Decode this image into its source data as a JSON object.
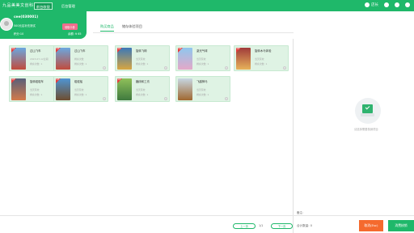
{
  "header": {
    "logo": "九品美美文创科技",
    "tabs": [
      {
        "label": "前台收银"
      },
      {
        "label": "后台管理"
      }
    ],
    "user_label": "店长",
    "colors": {
      "brand": "#1fb86a"
    }
  },
  "user": {
    "name": "cee(030001)",
    "shop": "500元店补充测试",
    "points": "积分:10",
    "action_button": "领取卡券",
    "balance": "余额: ¥ 65"
  },
  "tabs": [
    {
      "label": "购买商品"
    },
    {
      "label": "储存体验项目"
    }
  ],
  "cards": [
    {
      "title": "过山飞车",
      "line1": "2023-07-12过期",
      "line2": "剩余次数: 1",
      "tag": "免费"
    },
    {
      "title": "过山飞车",
      "line1": "剩余次数",
      "line2": "剩余次数: 1",
      "tag": "免费"
    },
    {
      "title": "旋转飞椅",
      "line1": "当天有效",
      "line2": "剩余次数: 1",
      "tag": "免费"
    },
    {
      "title": "激光气球",
      "line1": "当天有效",
      "line2": "剩余次数: 1",
      "tag": "免费"
    },
    {
      "title": "旋转木马体验",
      "line1": "当天有效",
      "line2": "剩余次数: 1",
      "tag": "免费"
    },
    {
      "title": "旋转碰碰车",
      "line1": "当天有效",
      "line2": "剩余次数: 1",
      "tag": "免费"
    },
    {
      "title": "碰碰船",
      "line1": "当天有效",
      "line2": "剩余次数: 1",
      "tag": "免费"
    },
    {
      "title": "蹦床和工坊",
      "line1": "当天有效",
      "line2": "剩余次数: 1",
      "tag": "免费"
    },
    {
      "title": "飞越神马",
      "line1": "当天有效",
      "line2": "剩余次数: 1",
      "tag": ""
    }
  ],
  "empty": {
    "text": "请选择需要核销项目"
  },
  "remark_label": "备注:",
  "pagination": {
    "prev": "上一页",
    "info": "1/1",
    "next": "下一页"
  },
  "total": "合计数量: 0",
  "actions": {
    "cancel": "取消(Esc)",
    "confirm": "消费核销"
  }
}
